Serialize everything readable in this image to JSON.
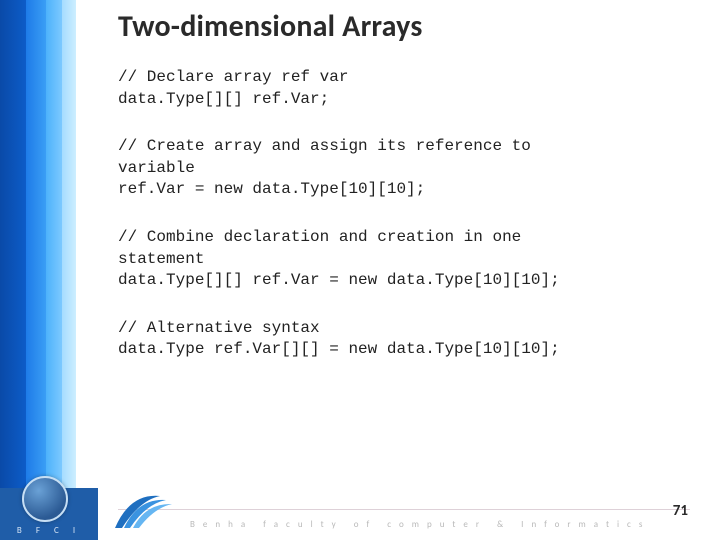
{
  "title": "Two-dimensional Arrays",
  "blocks": [
    {
      "lines": [
        "// Declare array ref var",
        "data.Type[][] ref.Var;"
      ]
    },
    {
      "lines": [
        "// Create array and assign its reference to",
        "variable",
        "ref.Var = new data.Type[10][10];"
      ]
    },
    {
      "lines": [
        "// Combine declaration and creation in one",
        "statement",
        "data.Type[][] ref.Var = new data.Type[10][10];"
      ]
    },
    {
      "lines": [
        "// Alternative syntax",
        "data.Type ref.Var[][] = new data.Type[10][10];"
      ]
    }
  ],
  "footer": {
    "bfci": "B F C I",
    "faculty": "Benha faculty of computer & Informatics"
  },
  "page_number": "71"
}
